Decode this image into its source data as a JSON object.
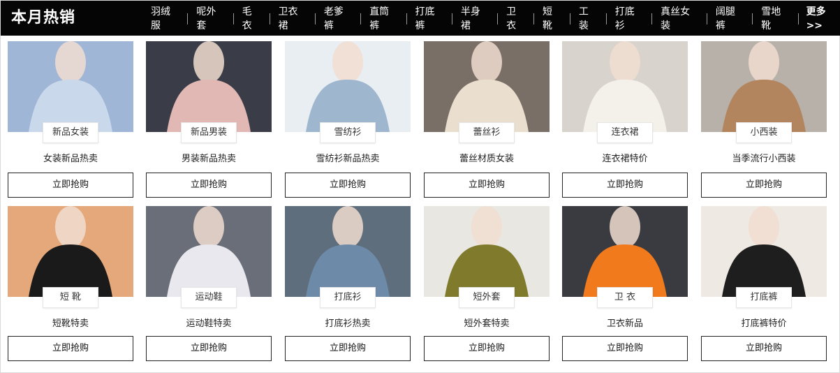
{
  "header": {
    "title": "本月热销",
    "nav": [
      "羽绒服",
      "呢外套",
      "毛衣",
      "卫衣裙",
      "老爹裤",
      "直筒裤",
      "打底裤",
      "半身裙",
      "卫衣",
      "短靴",
      "工装",
      "打底衫",
      "真丝女装",
      "阔腿裤",
      "雪地靴"
    ],
    "more": "更多>>"
  },
  "products": [
    {
      "tag": "新品女装",
      "desc": "女装新品热卖",
      "button": "立即抢购",
      "bg": "#9fb6d6",
      "fg": "#c9d8ea"
    },
    {
      "tag": "新品男装",
      "desc": "男装新品热卖",
      "button": "立即抢购",
      "bg": "#3a3d48",
      "fg": "#e2b8b4"
    },
    {
      "tag": "雪纺衫",
      "desc": "雪纺衫新品热卖",
      "button": "立即抢购",
      "bg": "#e9eef3",
      "fg": "#9eb7cf"
    },
    {
      "tag": "蕾丝衫",
      "desc": "蕾丝材质女装",
      "button": "立即抢购",
      "bg": "#7a6f66",
      "fg": "#eadfce"
    },
    {
      "tag": "连衣裙",
      "desc": "连衣裙特价",
      "button": "立即抢购",
      "bg": "#d8d3cc",
      "fg": "#f4f1ea"
    },
    {
      "tag": "小西装",
      "desc": "当季流行小西装",
      "button": "立即抢购",
      "bg": "#b7b1aa",
      "fg": "#b3855e"
    },
    {
      "tag": "短 靴",
      "desc": "短靴特卖",
      "button": "立即抢购",
      "bg": "#e5a87a",
      "fg": "#1a1a1a"
    },
    {
      "tag": "运动鞋",
      "desc": "运动鞋特卖",
      "button": "立即抢购",
      "bg": "#6a6e78",
      "fg": "#e8e8ee"
    },
    {
      "tag": "打底衫",
      "desc": "打底衫热卖",
      "button": "立即抢购",
      "bg": "#5f6e7c",
      "fg": "#6d8aa8"
    },
    {
      "tag": "短外套",
      "desc": "短外套特卖",
      "button": "立即抢购",
      "bg": "#e9e7e1",
      "fg": "#7f7a2c"
    },
    {
      "tag": "卫 衣",
      "desc": "卫衣新品",
      "button": "立即抢购",
      "bg": "#3a3b40",
      "fg": "#f07a1c"
    },
    {
      "tag": "打底裤",
      "desc": "打底裤特价",
      "button": "立即抢购",
      "bg": "#efe9e3",
      "fg": "#1e1e1e"
    }
  ]
}
